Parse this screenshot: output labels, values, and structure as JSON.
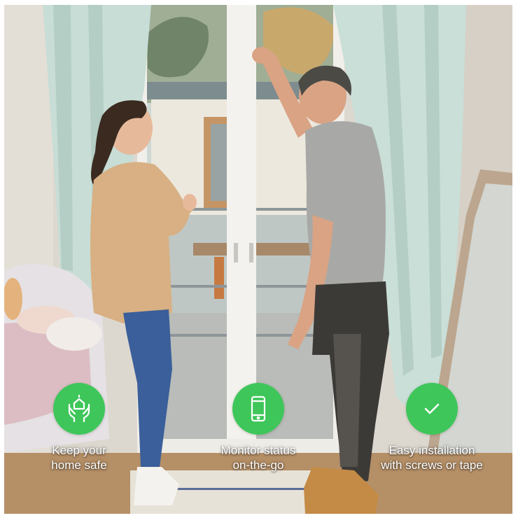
{
  "accent_color": "#3fc65a",
  "features": [
    {
      "icon": "hands-house-icon",
      "label": "Keep your\nhome safe"
    },
    {
      "icon": "smartphone-icon",
      "label": "Monitor status\non-the-go"
    },
    {
      "icon": "checkmark-icon",
      "label": "Easy installation\nwith screws or tape"
    }
  ]
}
